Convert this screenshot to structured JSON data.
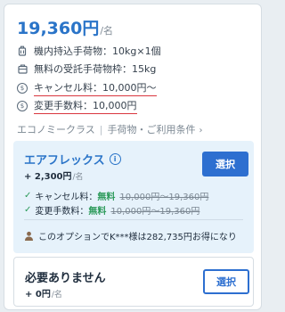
{
  "fare": {
    "price": "19,360円",
    "per_unit": "/名"
  },
  "features": [
    {
      "icon": "carry-on-bag-icon",
      "text": "機内持込手荷物：10kg×1個"
    },
    {
      "icon": "checked-bag-icon",
      "text": "無料の受託手荷物枠：15kg"
    },
    {
      "icon": "dollar-circle-icon",
      "text": "キャンセル料：10,000円〜"
    },
    {
      "icon": "dollar-circle-icon",
      "text": "変更手数料：10,000円"
    }
  ],
  "class_row": {
    "class_name": "エコノミークラス",
    "separator": "|",
    "link_text": "手荷物・ご利用条件"
  },
  "options": {
    "flex": {
      "name": "エアフレックス",
      "add_price": "+ 2,300円",
      "per_unit": "/名",
      "select_label": "選択",
      "perks": [
        {
          "label": "キャンセル料：",
          "free": "無料",
          "old": "10,000円〜19,360円"
        },
        {
          "label": "変更手数料：",
          "free": "無料",
          "old": "10,000円〜19,360円"
        }
      ],
      "promo": "このオプションでK***様は282,735円お得になり"
    },
    "none": {
      "name": "必要ありません",
      "add_price": "+ 0円",
      "per_unit": "/名",
      "select_label": "選択"
    }
  },
  "colors": {
    "accent": "#2a74c8",
    "button": "#2d6fd0",
    "free": "#2c9a5a",
    "underline": "#d9363e",
    "option_bg": "#e6f2fb"
  }
}
